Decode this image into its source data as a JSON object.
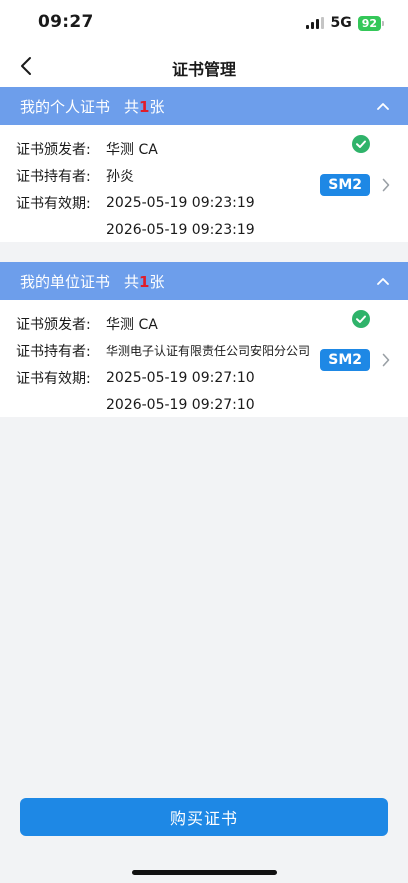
{
  "status": {
    "time": "09:27",
    "network": "5G",
    "battery": "92"
  },
  "nav": {
    "title": "证书管理"
  },
  "personal": {
    "title": "我的个人证书",
    "count_prefix": "共",
    "count": "1",
    "count_suffix": "张",
    "issuer_label": "证书颁发者:",
    "issuer": "华测 CA",
    "holder_label": "证书持有者:",
    "holder": "孙炎",
    "validity_label": "证书有效期:",
    "valid_from": "2025-05-19 09:23:19",
    "valid_to": "2026-05-19 09:23:19",
    "algorithm": "SM2"
  },
  "organization": {
    "title": "我的单位证书",
    "count_prefix": "共",
    "count": "1",
    "count_suffix": "张",
    "issuer_label": "证书颁发者:",
    "issuer": "华测 CA",
    "holder_label": "证书持有者:",
    "holder": "华测电子认证有限责任公司安阳分公司",
    "validity_label": "证书有效期:",
    "valid_from": "2025-05-19 09:27:10",
    "valid_to": "2026-05-19 09:27:10",
    "algorithm": "SM2"
  },
  "actions": {
    "buy_label": "购买证书"
  },
  "colors": {
    "accent": "#1e88e5",
    "header": "#6d9eeb",
    "valid": "#2fb36a",
    "count": "#e11d2a"
  }
}
